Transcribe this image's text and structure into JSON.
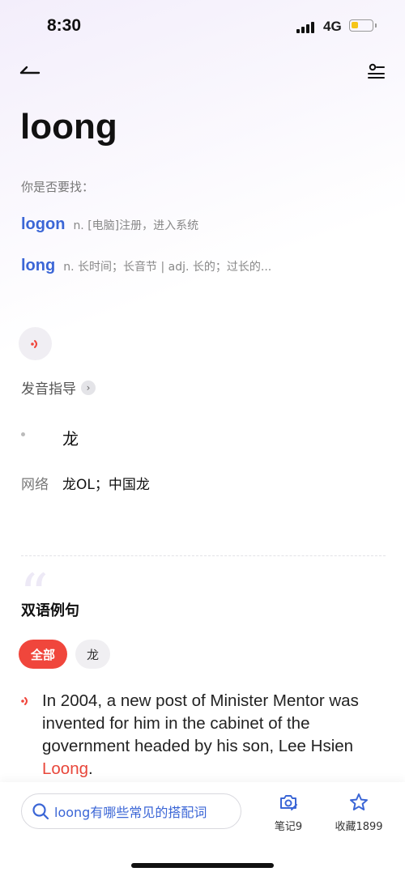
{
  "status_bar": {
    "time": "8:30",
    "network": "4G",
    "battery_level": 0.35,
    "battery_color": "#f5c518"
  },
  "header": {
    "back_icon": "back-arrow-icon",
    "filter_icon": "filter-settings-icon"
  },
  "word": "loong",
  "did_you_mean": "你是否要找：",
  "suggestions": [
    {
      "word": "logon",
      "def": "n. [电脑]注册，进入系统"
    },
    {
      "word": "long",
      "def": "n. 长时间；长音节 | adj. 长的；过长的..."
    }
  ],
  "pronunciation": {
    "guide_label": "发音指导",
    "arrow": "›"
  },
  "meaning": "龙",
  "network_meaning": {
    "label": "网络",
    "value": "龙OL；中国龙"
  },
  "examples": {
    "title": "双语例句",
    "filters": [
      {
        "label": "全部",
        "selected": true
      },
      {
        "label": "龙",
        "selected": false
      }
    ],
    "sentence_before": "In 2004, a new post of Minister Mentor was invented for him in the cabinet of the government headed by his son, Lee Hsien ",
    "sentence_highlight": "Loong",
    "sentence_after": "."
  },
  "bottom_bar": {
    "search_placeholder": "loong有哪些常见的搭配词",
    "note_label": "笔记9",
    "favorite_label": "收藏1899"
  },
  "colors": {
    "accent_red": "#f0463c",
    "link_blue": "#3b66d6"
  }
}
